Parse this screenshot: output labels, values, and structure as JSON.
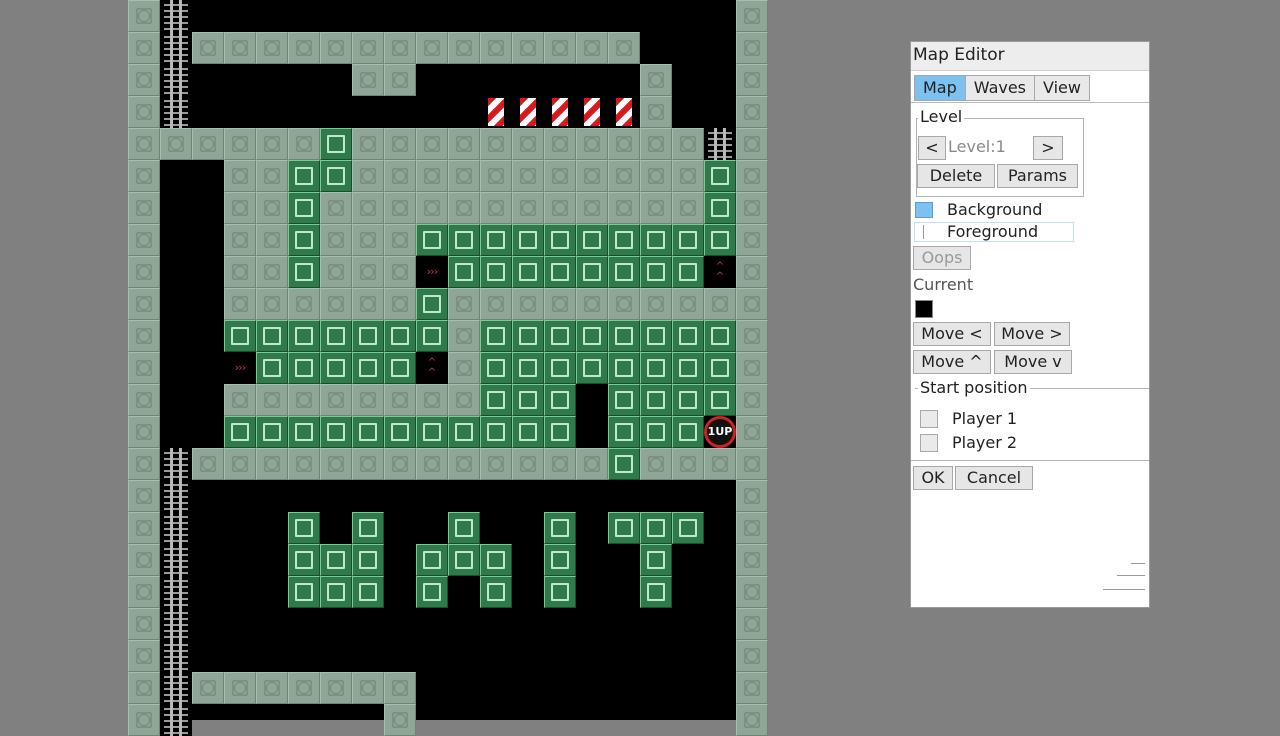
{
  "editor": {
    "title": "Map Editor",
    "tabs": [
      "Map",
      "Waves",
      "View"
    ],
    "active_tab": "Map",
    "level": {
      "group_label": "Level",
      "prev_label": "<",
      "current": "Level:1",
      "next_label": ">",
      "delete_label": "Delete",
      "params_label": "Params"
    },
    "layers": [
      "Background",
      "Foreground"
    ],
    "oops_label": "Oops",
    "current_label": "Current",
    "current_color": "#000000",
    "move": {
      "left": "Move <",
      "right": "Move >",
      "up": "Move ^",
      "down": "Move v"
    },
    "start_position": {
      "group_label": "Start position",
      "player1": "Player 1",
      "player2": "Player 2"
    },
    "ok_label": "OK",
    "cancel_label": "Cancel"
  },
  "map": {
    "oneup_text": "1UP",
    "colors": {
      "stone": "#8fa596",
      "brick": "#2f7a4a",
      "background": "#000000"
    }
  }
}
